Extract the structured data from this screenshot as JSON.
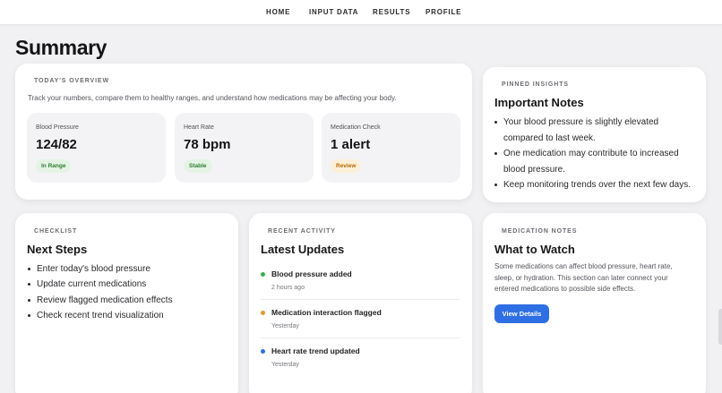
{
  "nav": {
    "items": [
      "HOME",
      "INPUT DATA",
      "RESULTS",
      "PROFILE"
    ]
  },
  "page": {
    "title": "Summary"
  },
  "overview": {
    "eyebrow": "TODAY'S OVERVIEW",
    "description": "Track your numbers, compare them to healthy ranges, and understand how medications may be affecting your body.",
    "metrics": [
      {
        "label": "Blood Pressure",
        "value": "124/82",
        "badge": "In Range",
        "badge_tone": "green"
      },
      {
        "label": "Heart Rate",
        "value": "78 bpm",
        "badge": "Stable",
        "badge_tone": "green"
      },
      {
        "label": "Medication Check",
        "value": "1 alert",
        "badge": "Review",
        "badge_tone": "orange"
      }
    ]
  },
  "insights": {
    "eyebrow": "PINNED INSIGHTS",
    "title": "Important Notes",
    "items": [
      "Your blood pressure is slightly elevated",
      "compared to last week.",
      "One medication may contribute to increased",
      "blood pressure.",
      "Keep monitoring trends over the next few days."
    ]
  },
  "checklist": {
    "eyebrow": "CHECKLIST",
    "title": "Next Steps",
    "items": [
      "Enter today's blood pressure",
      "Update current medications",
      "Review flagged medication effects",
      "Check recent trend visualization"
    ]
  },
  "activity": {
    "eyebrow": "RECENT ACTIVITY",
    "title": "Latest Updates",
    "items": [
      {
        "text": "Blood pressure added",
        "time": "2 hours ago",
        "dot_color": "#3fae4a"
      },
      {
        "text": "Medication interaction flagged",
        "time": "Yesterday",
        "dot_color": "#e39a2c"
      },
      {
        "text": "Heart rate trend updated",
        "time": "Yesterday",
        "dot_color": "#2f6fe4"
      }
    ]
  },
  "medication": {
    "eyebrow": "MEDICATION NOTES",
    "title": "What to Watch",
    "description_lines": [
      "Some medications can affect blood pressure, heart rate,",
      "sleep, or hydration. This section can later connect your",
      "entered medications to possible side effects."
    ],
    "button_label": "View Details"
  },
  "colors": {
    "accent": "#2f6fe4",
    "badge_green_bg": "#e4f3e4",
    "badge_orange_bg": "#fcefd9",
    "page_bg": "#f1f1f3"
  }
}
